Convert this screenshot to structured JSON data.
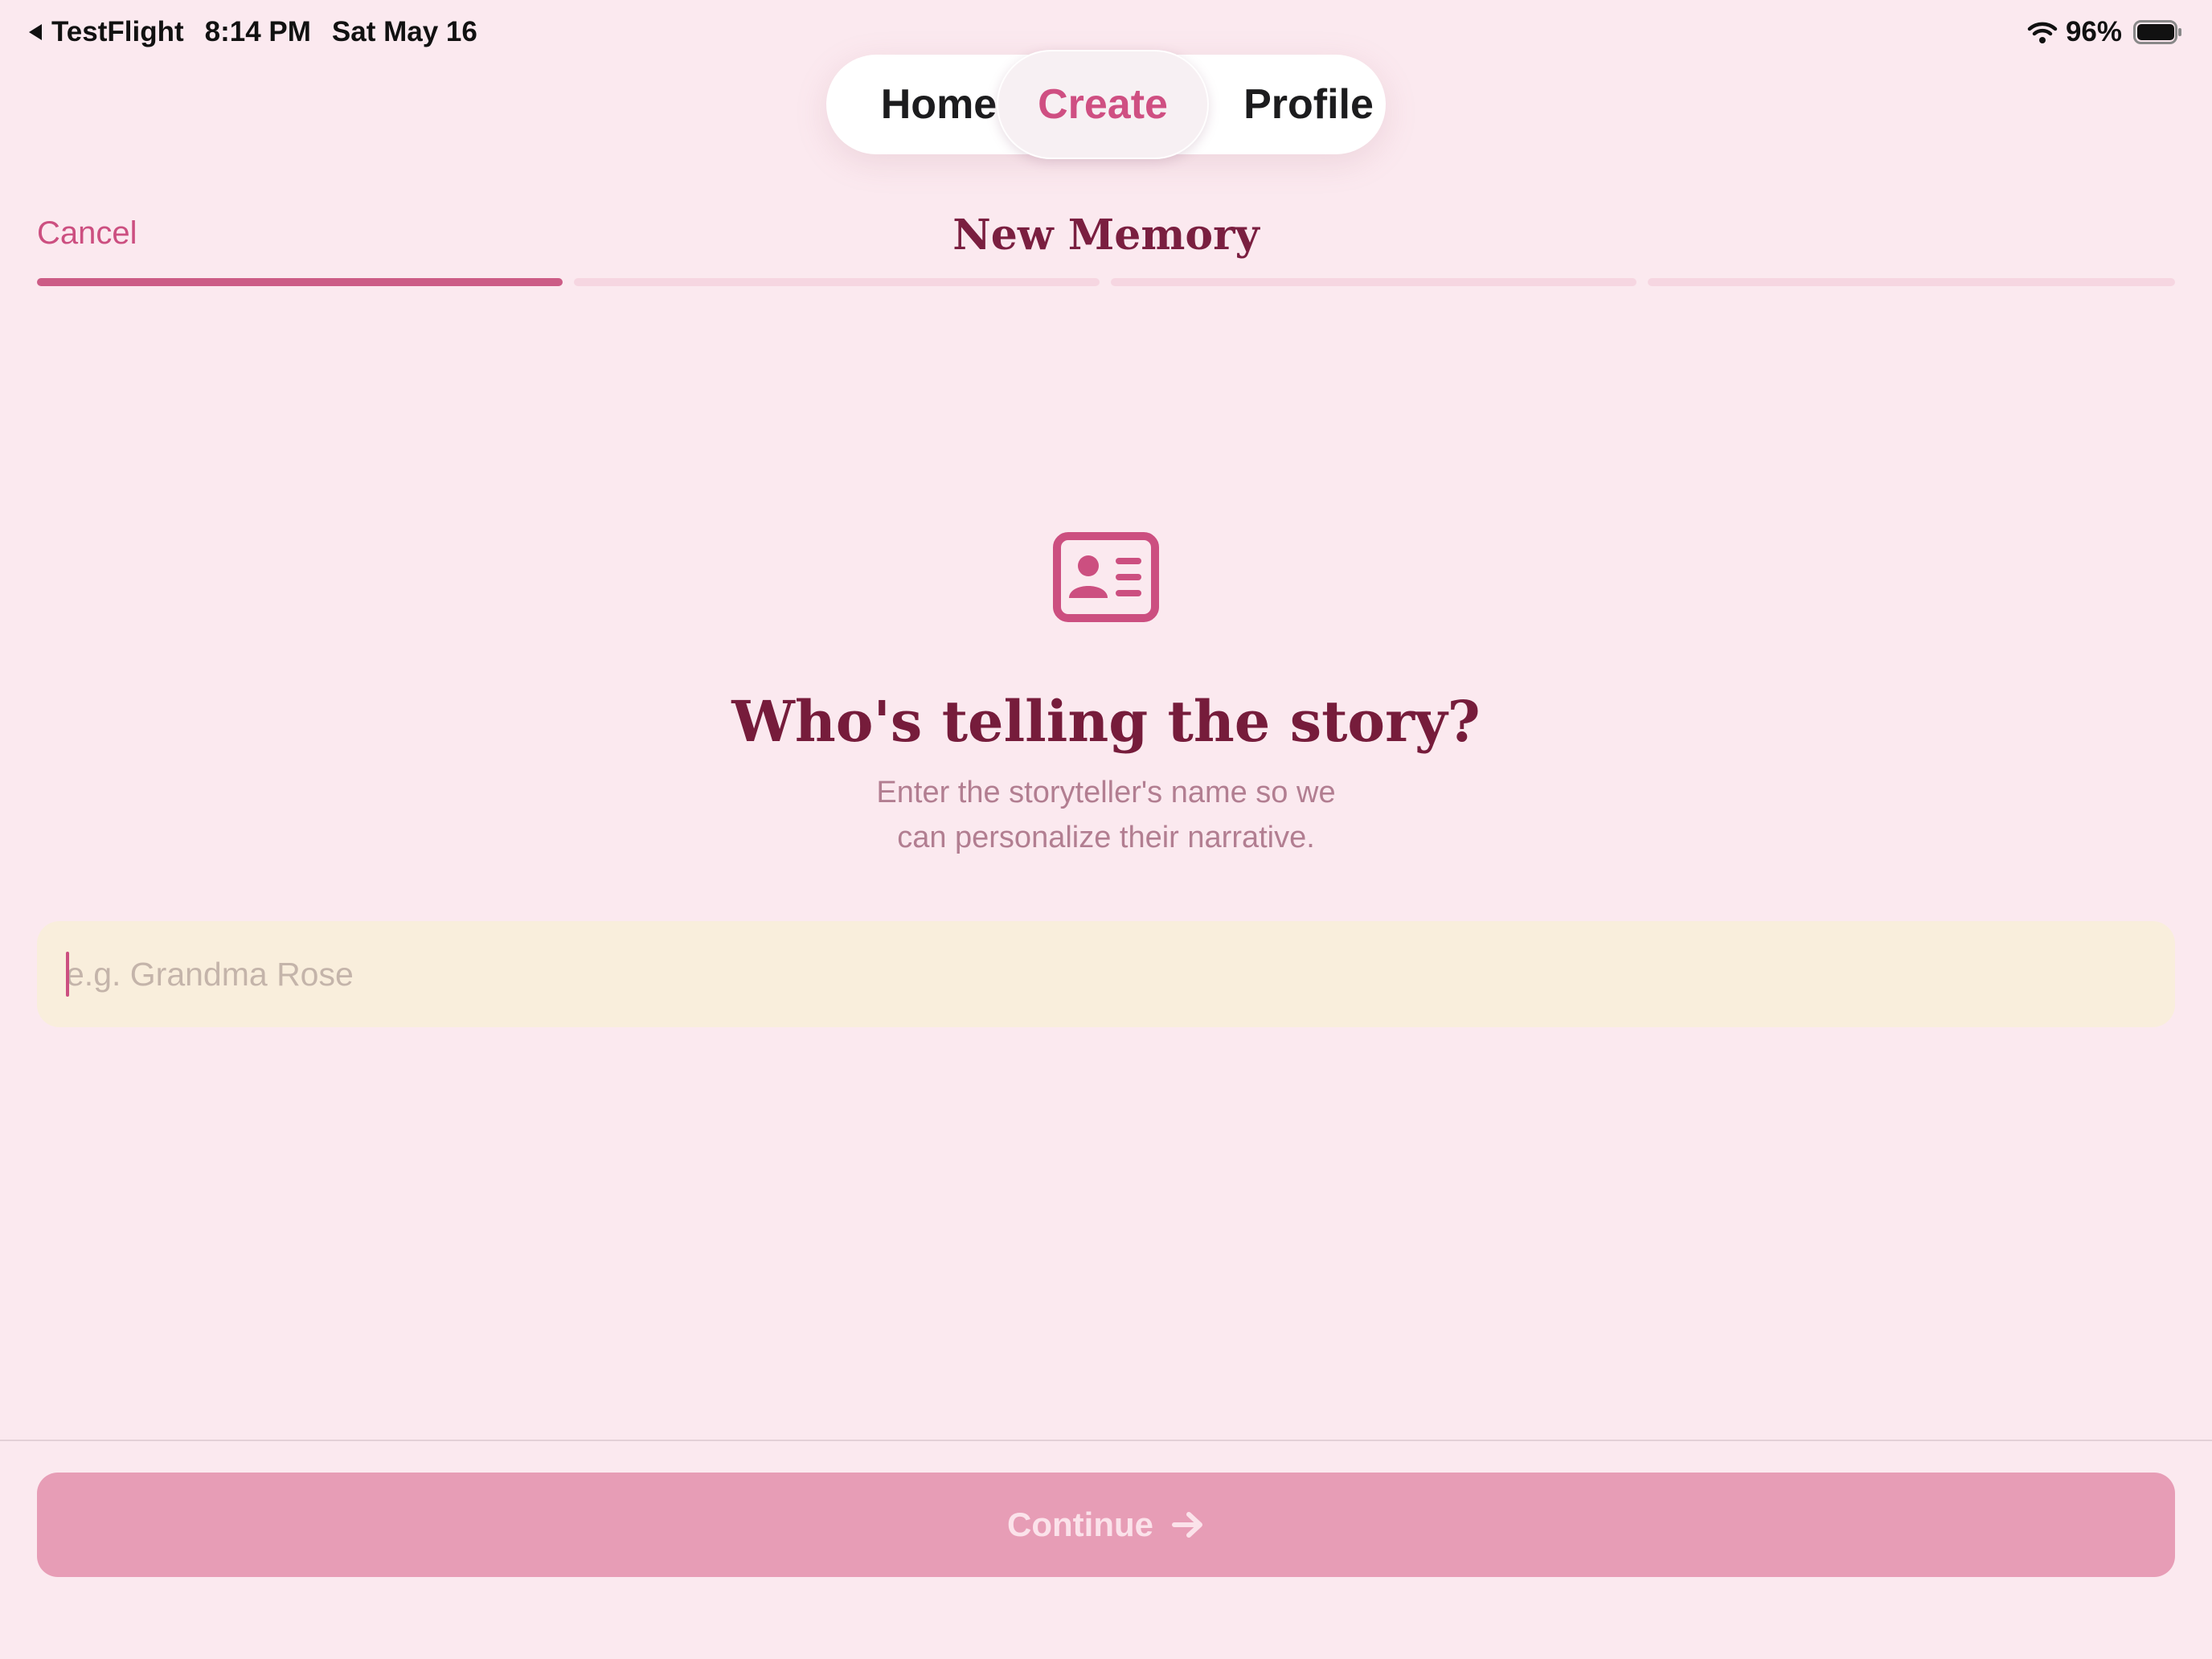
{
  "status_bar": {
    "back_app": "TestFlight",
    "time": "8:14 PM",
    "date": "Sat May 16",
    "battery": "96%",
    "icons": [
      "back-arrow-icon",
      "wifi-icon",
      "battery-icon"
    ]
  },
  "tabs": [
    {
      "label": "Home",
      "selected": false
    },
    {
      "label": "Create",
      "selected": true
    },
    {
      "label": "Profile",
      "selected": false
    }
  ],
  "header": {
    "cancel_label": "Cancel",
    "title": "New Memory"
  },
  "progress": {
    "total_steps": 4,
    "current_step": 1
  },
  "main": {
    "icon": "person-id-card-icon",
    "question": "Who's telling the story?",
    "subtitle_line1": "Enter the storyteller's name so we",
    "subtitle_line2": "can personalize their narrative.",
    "name_input": {
      "placeholder": "e.g. Grandma Rose",
      "value": ""
    }
  },
  "footer": {
    "continue_label": "Continue",
    "continue_icon": "arrow-right-icon",
    "continue_enabled": false
  },
  "colors": {
    "background": "#fbe9ef",
    "accent": "#cc4f80",
    "title": "#7a1f40",
    "progress_active": "#cc5c86",
    "progress_inactive": "#f6d6e1",
    "input_background": "#f9eedc",
    "button_disabled": "#e79db6"
  }
}
